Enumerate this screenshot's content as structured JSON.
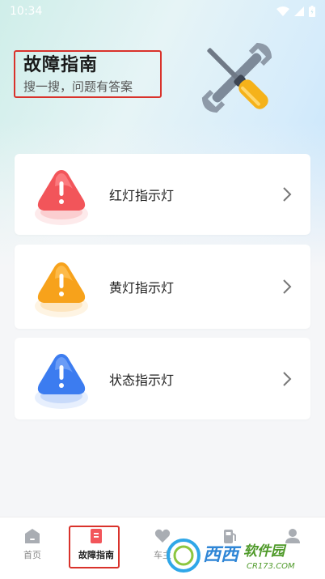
{
  "status_bar": {
    "time": "10:34"
  },
  "header": {
    "title": "故障指南",
    "subtitle": "搜一搜，问题有答案"
  },
  "icons": {
    "tools": "wrench-screwdriver-icon",
    "red": "red-warning-icon",
    "yellow": "yellow-warning-icon",
    "blue": "blue-warning-icon",
    "chevron": "chevron-right-icon"
  },
  "colors": {
    "red": "#f2555a",
    "yellow": "#f7a21b",
    "blue": "#3c7cf0",
    "highlight": "#d9322b"
  },
  "cards": [
    {
      "label": "红灯指示灯"
    },
    {
      "label": "黄灯指示灯"
    },
    {
      "label": "状态指示灯"
    }
  ],
  "bottom_nav": {
    "items": [
      {
        "label": "首页"
      },
      {
        "label": "故障指南"
      },
      {
        "label": "车主"
      }
    ]
  },
  "watermark": {
    "text": "西西软件园",
    "url_text": "CR173.COM"
  }
}
